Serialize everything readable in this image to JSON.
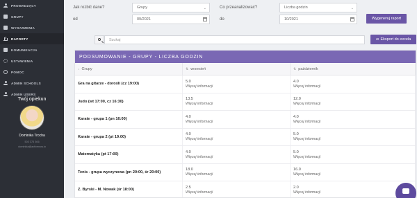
{
  "sidebar": {
    "items": [
      {
        "label": "PROWADZĄCY",
        "icon": "user-icon",
        "active": false
      },
      {
        "label": "GRUPY",
        "icon": "group-icon",
        "active": false
      },
      {
        "label": "WYDARZENIA",
        "icon": "calendar-icon",
        "active": false
      },
      {
        "label": "RAPORTY",
        "icon": "chart-icon",
        "active": true
      },
      {
        "label": "KOMUNIKACJA",
        "icon": "mail-icon",
        "active": false
      },
      {
        "label": "USTAWIENIA",
        "icon": "gear-icon",
        "active": false
      },
      {
        "label": "POMOC",
        "icon": "help-icon",
        "active": false
      },
      {
        "label": "ADMIN SCHOOLS",
        "icon": "school-icon",
        "active": false
      },
      {
        "label": "ADMIN USERS",
        "icon": "users-icon",
        "active": false
      }
    ],
    "tutor": {
      "title": "Twój opiekun",
      "name": "Dominika Trocha",
      "phone": "503 373 306",
      "email": "dominika@activenow.io"
    }
  },
  "filters": {
    "what_label": "Jak rozbić dane?",
    "what_value": "Grupy",
    "analyze_label": "Co przeanalizować?",
    "analyze_value": "Liczba godzin",
    "from_label": "od",
    "from_value": "09/2021",
    "to_label": "do",
    "to_value": "10/2021",
    "generate_label": "Wygeneruj raport"
  },
  "search": {
    "placeholder": "Szukaj",
    "export_label": "Eksport do excela"
  },
  "summary": {
    "title": "PODSUMOWANIE - GRUPY - LICZBA GODZIN",
    "columns": [
      "Grupy",
      "wrzesień",
      "październik"
    ],
    "more_label": "Więcej informacji",
    "rows": [
      {
        "group": "Gra na gitarze - dorośli (cz 19:00)",
        "sep": "5.0",
        "oct": "4.0"
      },
      {
        "group": "Judo (wt 17:00, cz 16:30)",
        "sep": "13.5",
        "oct": "12.0"
      },
      {
        "group": "Karate - grupa 1 (pn 16:00)",
        "sep": "4.0",
        "oct": "4.0"
      },
      {
        "group": "Karate - grupa 2 (pt 19:00)",
        "sep": "4.0",
        "oct": "5.0"
      },
      {
        "group": "Matematyka (pt 17:00)",
        "sep": "4.0",
        "oct": "5.0"
      },
      {
        "group": "Tenis - grupa wyczynowa (pn 20:00, śr 20:00)",
        "sep": "18.0",
        "oct": "16.0"
      },
      {
        "group": "Z. Byrski - M. Nowak (śr 18:00)",
        "sep": "2.5",
        "oct": "2.0"
      }
    ]
  }
}
